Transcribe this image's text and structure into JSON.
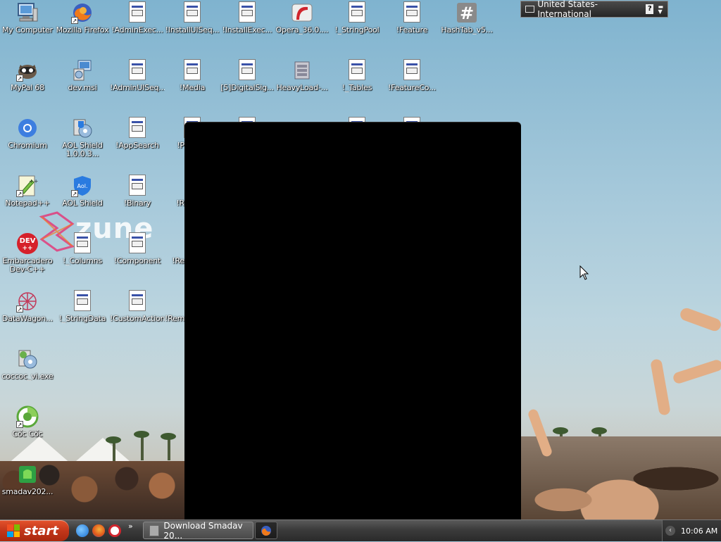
{
  "desktop": {
    "icons": [
      {
        "label": "My Computer",
        "icon": "computer-icon"
      },
      {
        "label": "Mozilla Firefox",
        "icon": "firefox-icon"
      },
      {
        "label": "!AdminExec...",
        "icon": "document-icon"
      },
      {
        "label": "!InstallUISeq...",
        "icon": "document-icon"
      },
      {
        "label": "!InstallExec...",
        "icon": "document-icon"
      },
      {
        "label": "Opera_36.0....",
        "icon": "opera-installer-icon"
      },
      {
        "label": "!_StringPool",
        "icon": "document-icon"
      },
      {
        "label": "!Feature",
        "icon": "document-icon"
      },
      {
        "label": "HashTab_v5...",
        "icon": "hashtab-icon"
      },
      {
        "label": "MyPal 68",
        "icon": "mypal-icon"
      },
      {
        "label": "dev.msi",
        "icon": "installer-icon"
      },
      {
        "label": "!AdminUISeq...",
        "icon": "document-icon"
      },
      {
        "label": "!Media",
        "icon": "document-icon"
      },
      {
        "label": "[5]DigitalSig...",
        "icon": "document-icon"
      },
      {
        "label": "HeavyLoad-...",
        "icon": "heavyload-icon"
      },
      {
        "label": "!_Tables",
        "icon": "document-icon"
      },
      {
        "label": "!FeatureCo...",
        "icon": "document-icon"
      },
      {
        "label": "Chromium",
        "icon": "chromium-icon"
      },
      {
        "label": "AOL Shield 1.0.0.3...",
        "icon": "aol-shield-installer-icon"
      },
      {
        "label": "!AppSearch",
        "icon": "document-icon"
      },
      {
        "label": "!P",
        "icon": "document-icon"
      },
      {
        "label": "Notepad++",
        "icon": "notepadpp-icon"
      },
      {
        "label": "AOL Shield",
        "icon": "aol-shield-icon"
      },
      {
        "label": "!Binary",
        "icon": "document-icon"
      },
      {
        "label": "!R",
        "icon": "document-icon"
      },
      {
        "label": "Embarcadero Dev-C++",
        "icon": "devcpp-icon"
      },
      {
        "label": "!_Columns",
        "icon": "document-icon"
      },
      {
        "label": "!Component",
        "icon": "document-icon"
      },
      {
        "label": "!Re",
        "icon": "document-icon"
      },
      {
        "label": "DataWagon...",
        "icon": "datawagon-icon"
      },
      {
        "label": "!_StringData",
        "icon": "document-icon"
      },
      {
        "label": "!CustomAction",
        "icon": "document-icon"
      },
      {
        "label": "!Rem",
        "icon": "document-icon"
      },
      {
        "label": "coccoc_vi.exe",
        "icon": "installer-icon"
      },
      {
        "label": "Cốc Cốc",
        "icon": "coccoc-icon"
      },
      {
        "label": "smadav202...",
        "icon": "smadav-icon"
      }
    ],
    "zune_overlay": "zune"
  },
  "language_bar": {
    "label": "United States-International",
    "help": "?"
  },
  "taskbar": {
    "start_label": "start",
    "quick_launch": [
      "ie-icon",
      "firefox-icon",
      "opera-icon"
    ],
    "more": "»",
    "tasks": [
      {
        "label": "Download Smadav 20...",
        "icon": "smadav-icon"
      },
      {
        "label": "",
        "icon": "firefox-icon"
      }
    ],
    "clock": "10:06 AM"
  }
}
